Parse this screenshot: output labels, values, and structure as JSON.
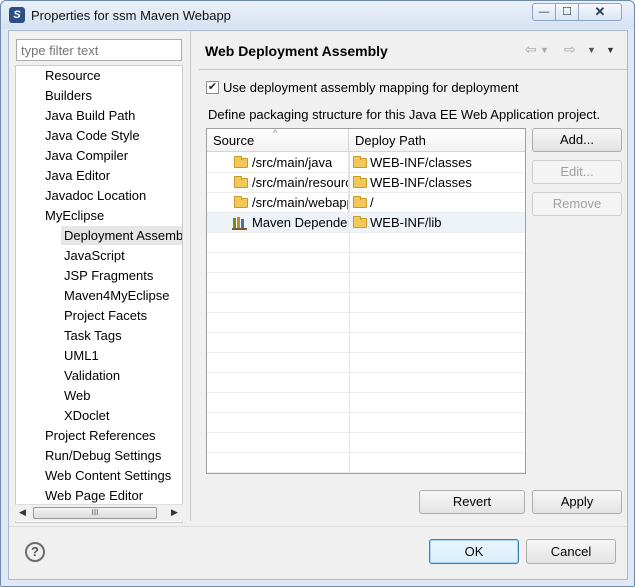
{
  "window": {
    "title": "Properties for ssm Maven Webapp",
    "icon": "eclipse-s-logo",
    "controls": {
      "minimize": "—",
      "maximize": "☐",
      "close": "✕"
    }
  },
  "filter": {
    "placeholder": "type filter text"
  },
  "tree": {
    "items": [
      "Resource",
      "Builders",
      "Java Build Path",
      "Java Code Style",
      "Java Compiler",
      "Java Editor",
      "Javadoc Location",
      "MyEclipse",
      "Deployment Assembly",
      "JavaScript",
      "JSP Fragments",
      "Maven4MyEclipse",
      "Project Facets",
      "Task Tags",
      "UML1",
      "Validation",
      "Web",
      "XDoclet",
      "Project References",
      "Run/Debug Settings",
      "Web Content Settings",
      "Web Page Editor"
    ],
    "selected": "Deployment Assembly",
    "scroll_grip": "III"
  },
  "page": {
    "title": "Web Deployment Assembly",
    "checkbox_label": "Use deployment assembly mapping for deployment",
    "checkbox_checked": true,
    "description": "Define packaging structure for this Java EE Web Application project.",
    "table": {
      "headers": {
        "source": "Source",
        "deploy": "Deploy Path"
      },
      "rows": [
        {
          "source": "/src/main/java",
          "deploy": "WEB-INF/classes",
          "icon": "folder-icon"
        },
        {
          "source": "/src/main/resources",
          "deploy": "WEB-INF/classes",
          "icon": "folder-icon"
        },
        {
          "source": "/src/main/webapp",
          "deploy": "/",
          "icon": "folder-icon"
        },
        {
          "source": "Maven Dependencies",
          "deploy": "WEB-INF/lib",
          "icon": "library-icon"
        }
      ]
    },
    "buttons": {
      "add": "Add...",
      "edit": "Edit...",
      "remove": "Remove",
      "revert": "Revert",
      "apply": "Apply"
    }
  },
  "footer": {
    "ok": "OK",
    "cancel": "Cancel",
    "help": "?"
  }
}
